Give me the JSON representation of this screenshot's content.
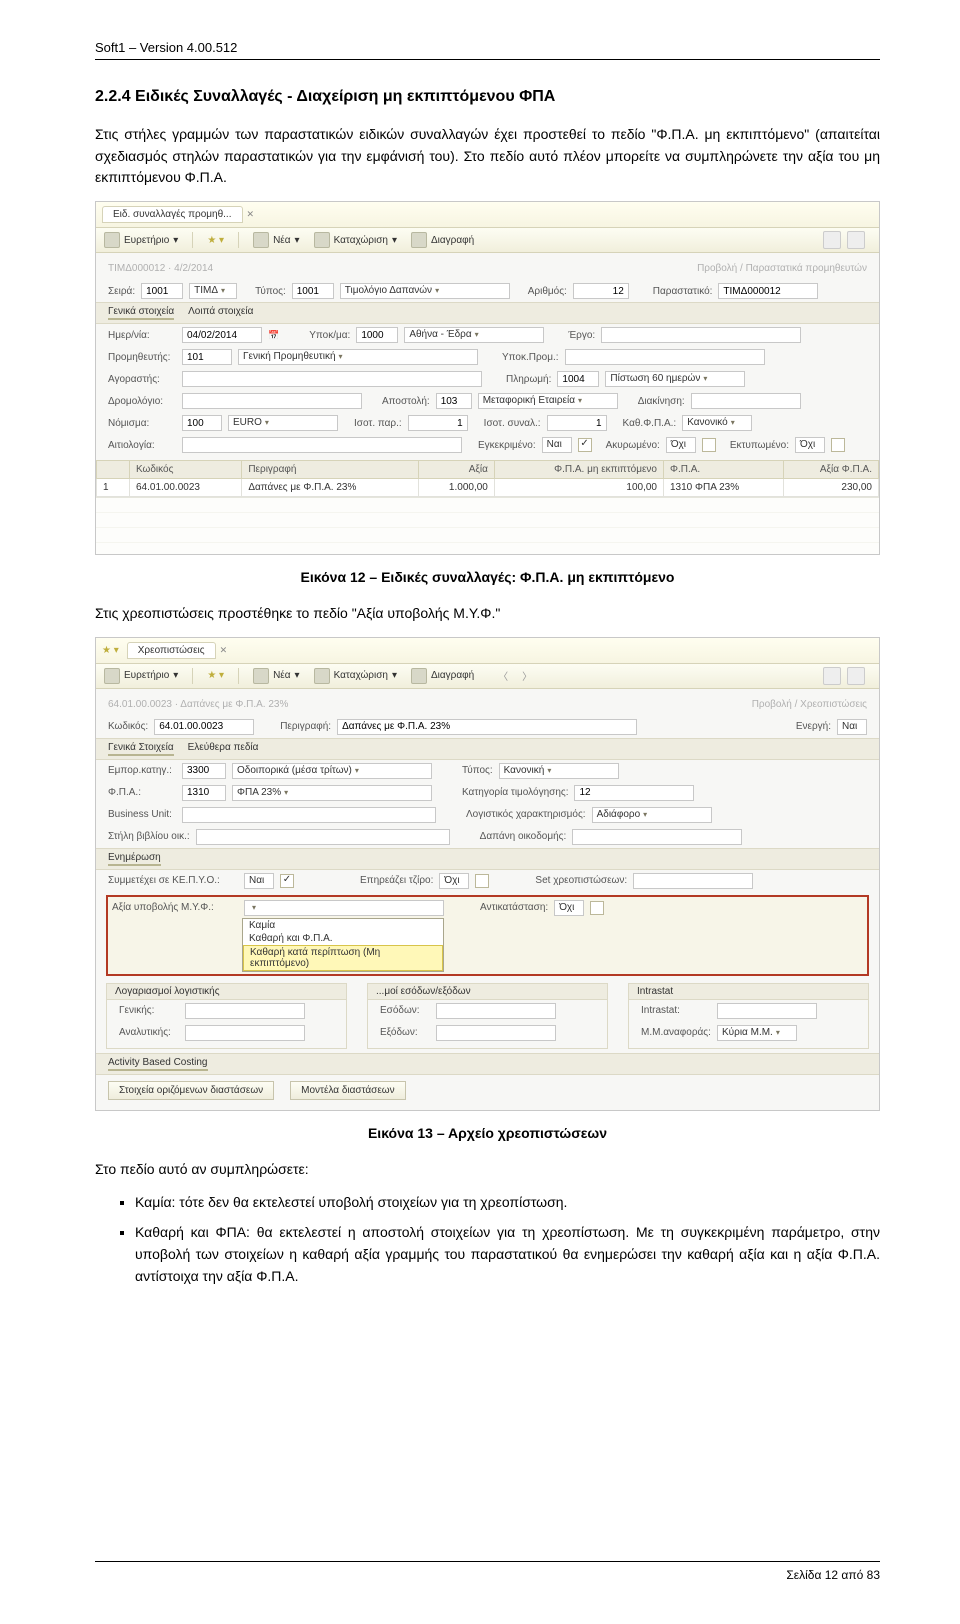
{
  "header": "Soft1 – Version 4.00.512",
  "h2": "2.2.4 Ειδικές Συναλλαγές - Διαχείριση μη εκπιπτόμενου ΦΠΑ",
  "p1": "Στις στήλες γραμμών των παραστατικών ειδικών συναλλαγών έχει προστεθεί το πεδίο \"Φ.Π.Α. μη εκπιπτόμενο\" (απαιτείται σχεδιασμός στηλών παραστατικών για την εμφάνισή του). Στο πεδίο αυτό πλέον μπορείτε να συμπληρώνετε την αξία του μη εκπιπτόμενου Φ.Π.Α.",
  "caption1": "Εικόνα 12 – Ειδικές συναλλαγές: Φ.Π.Α. μη εκπιπτόμενο",
  "p2": "Στις χρεοπιστώσεις προστέθηκε το πεδίο \"Αξία υποβολής Μ.Υ.Φ.\"",
  "caption2": "Εικόνα 13 – Αρχείο χρεοπιστώσεων",
  "p3": "Στο πεδίο αυτό αν συμπληρώσετε:",
  "bullets": [
    "Καμία: τότε δεν θα εκτελεστεί υποβολή στοιχείων για τη χρεοπίστωση.",
    "Καθαρή και ΦΠΑ: θα εκτελεστεί η αποστολή στοιχείων για τη χρεοπίστωση. Με τη συγκεκριμένη παράμετρο, στην υποβολή των στοιχείων η καθαρή αξία γραμμής του παραστατικού θα ενημερώσει την καθαρή αξία και η αξία Φ.Π.Α. αντίστοιχα την αξία Φ.Π.Α."
  ],
  "footer": "Σελίδα 12 από 83",
  "shot1": {
    "tab": "Ειδ. συναλλαγές προμηθ...",
    "toolbar": {
      "index": "Ευρετήριο",
      "new": "Νέα",
      "save": "Καταχώριση",
      "del": "Διαγραφή"
    },
    "crumbR": "Προβολή / Παραστατικά προμηθευτών",
    "l_seira": "Σειρά:",
    "seira_code": "1001",
    "seira_txt": "ΤΙΜΔ",
    "l_typos": "Τύπος:",
    "typos_code": "1001",
    "typos_txt": "Τιμολόγιο Δαπανών",
    "l_arith": "Αριθμός:",
    "arith": "12",
    "l_par": "Παραστατικό:",
    "par": "TIMΔ000012",
    "tab1": "Γενικά στοιχεία",
    "tab2": "Λοιπά στοιχεία",
    "l_date": "Ημερ/νία:",
    "date": "04/02/2014",
    "l_ypok": "Υποκ/μα:",
    "ypok_c": "1000",
    "ypok_t": "Αθήνα - Έδρα",
    "l_ergo": "Έργο:",
    "l_prom": "Προμηθευτής:",
    "prom_c": "101",
    "prom_t": "Γενική Προμηθευτική",
    "l_ypp": "Υποκ.Προμ.:",
    "l_ag": "Αγοραστής:",
    "l_plir": "Πληρωμή:",
    "plir_c": "1004",
    "plir_t": "Πίστωση 60 ημερών",
    "l_drom": "Δρομολόγιο:",
    "l_apos": "Αποστολή:",
    "apos_c": "103",
    "apos_t": "Μεταφορική Εταιρεία",
    "l_diak": "Διακίνηση:",
    "l_nom": "Νόμισμα:",
    "nom_c": "100",
    "nom_t": "EURO",
    "l_isotp": "Ισοτ. παρ.:",
    "isotp": "1",
    "l_isots": "Ισοτ. συναλ.:",
    "isots": "1",
    "l_kath": "Καθ.Φ.Π.Α.:",
    "kath": "Κανονικό",
    "l_ait": "Αιτιολογία:",
    "l_egk": "Εγκεκριμένο:",
    "egk": "Ναι",
    "l_akyr": "Ακυρωμένο:",
    "akyr": "Όχι",
    "l_ekt": "Εκτυπωμένο:",
    "ekt": "Όχι",
    "th": [
      "",
      "Κωδικός",
      "Περιγραφή",
      "Αξία",
      "Φ.Π.Α. μη εκπιπτόμενο",
      "Φ.Π.Α.",
      "Αξία Φ.Π.Α."
    ],
    "td": [
      "1",
      "64.01.00.0023",
      "Δαπάνες με Φ.Π.Α. 23%",
      "1.000,00",
      "100,00",
      "1310 ΦΠΑ 23%",
      "230,00"
    ]
  },
  "shot2": {
    "tab": "Χρεοπιστώσεις",
    "toolbar": {
      "index": "Ευρετήριο",
      "new": "Νέα",
      "save": "Καταχώριση",
      "del": "Διαγραφή"
    },
    "crumbL": "64.01.00.0023 · Δαπάνες με Φ.Π.Α. 23%",
    "crumbR": "Προβολή / Χρεοπιστώσεις",
    "l_code": "Κωδικός:",
    "code": "64.01.00.0023",
    "l_per": "Περιγραφή:",
    "per": "Δαπάνες με Φ.Π.Α. 23%",
    "l_en": "Ενεργή:",
    "en": "Ναι",
    "tab1": "Γενικά Στοιχεία",
    "tab2": "Ελεύθερα πεδία",
    "l_emp": "Εμπορ.κατηγ.:",
    "emp_c": "3300",
    "emp_t": "Οδοιπορικά (μέσα τρίτων)",
    "l_typ": "Τύπος:",
    "typ": "Κανονική",
    "l_fpa": "Φ.Π.Α.:",
    "fpa_c": "1310",
    "fpa_t": "ΦΠΑ 23%",
    "l_kt": "Κατηγορία τιμολόγησης:",
    "kt": "12",
    "l_bu": "Business Unit:",
    "l_lx": "Λογιστικός χαρακτηρισμός:",
    "lx": "Αδιάφορο",
    "l_st": "Στήλη βιβλίου οικ.:",
    "l_dap": "Δαπάνη οικοδομής:",
    "sec_en": "Ενημέρωση",
    "l_kepyo": "Συμμετέχει σε ΚΕ.Π.Υ.Ο.:",
    "kepyo": "Ναι",
    "l_epir": "Επηρεάζει τζίρο:",
    "epir": "Όχι",
    "l_set": "Set χρεοπιστώσεων:",
    "l_axia": "Αξία υποβολής Μ.Υ.Φ.:",
    "l_anti": "Αντικατάσταση:",
    "anti": "Όχι",
    "opt0": "Καμία",
    "opt1": "Καθαρή και Φ.Π.Α.",
    "opt2": "Καθαρή κατά περίπτωση (Μη εκπιπτόμενο)",
    "box1": "Λογαριασμοί λογιστικής",
    "box2": "...μοί εσόδων/εξόδων",
    "box3": "Intrastat",
    "l_gen": "Γενικής:",
    "l_esod": "Εσόδων:",
    "l_intr": "Intrastat:",
    "l_anal": "Αναλυτικής:",
    "l_exod": "Εξόδων:",
    "l_mm": "Μ.Μ.αναφοράς:",
    "mm": "Κύρια Μ.Μ.",
    "sec_abc": "Activity Based Costing",
    "btn1": "Στοιχεία οριζόμενων διαστάσεων",
    "btn2": "Μοντέλα διαστάσεων"
  }
}
